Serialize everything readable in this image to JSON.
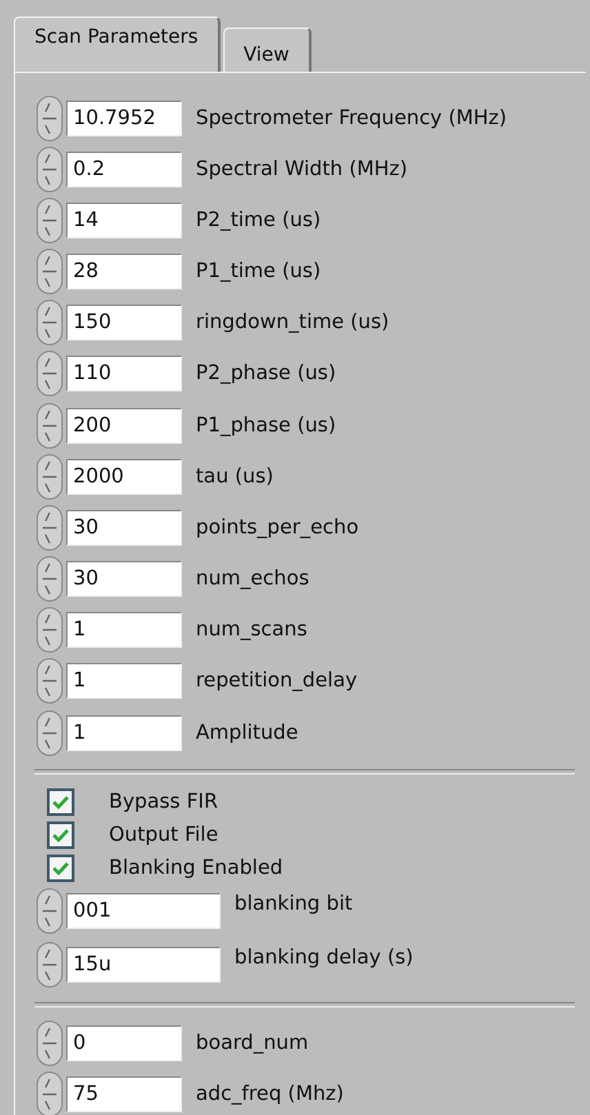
{
  "tabs": [
    {
      "label": "Scan Parameters",
      "selected": true
    },
    {
      "label": "View",
      "selected": false
    }
  ],
  "parameters": [
    {
      "value": "10.7952",
      "label": "Spectrometer Frequency (MHz)"
    },
    {
      "value": "0.2",
      "label": "Spectral Width (MHz)"
    },
    {
      "value": "14",
      "label": "P2_time (us)"
    },
    {
      "value": "28",
      "label": "P1_time (us)"
    },
    {
      "value": "150",
      "label": "ringdown_time (us)"
    },
    {
      "value": "110",
      "label": "P2_phase (us)"
    },
    {
      "value": "200",
      "label": "P1_phase (us)"
    },
    {
      "value": "2000",
      "label": "tau (us)"
    },
    {
      "value": "30",
      "label": "points_per_echo"
    },
    {
      "value": "30",
      "label": "num_echos"
    },
    {
      "value": "1",
      "label": "num_scans"
    },
    {
      "value": "1",
      "label": "repetition_delay"
    },
    {
      "value": "1",
      "label": "Amplitude"
    }
  ],
  "options": [
    {
      "label": "Bypass FIR",
      "checked": true
    },
    {
      "label": "Output File",
      "checked": true
    },
    {
      "label": "Blanking Enabled",
      "checked": true
    }
  ],
  "blanking": [
    {
      "value": "001",
      "label": "blanking bit"
    },
    {
      "value": "15u",
      "label": "blanking delay (s)"
    }
  ],
  "board": [
    {
      "value": "0",
      "label": "board_num"
    },
    {
      "value": "75",
      "label": "adc_freq (Mhz)"
    }
  ]
}
